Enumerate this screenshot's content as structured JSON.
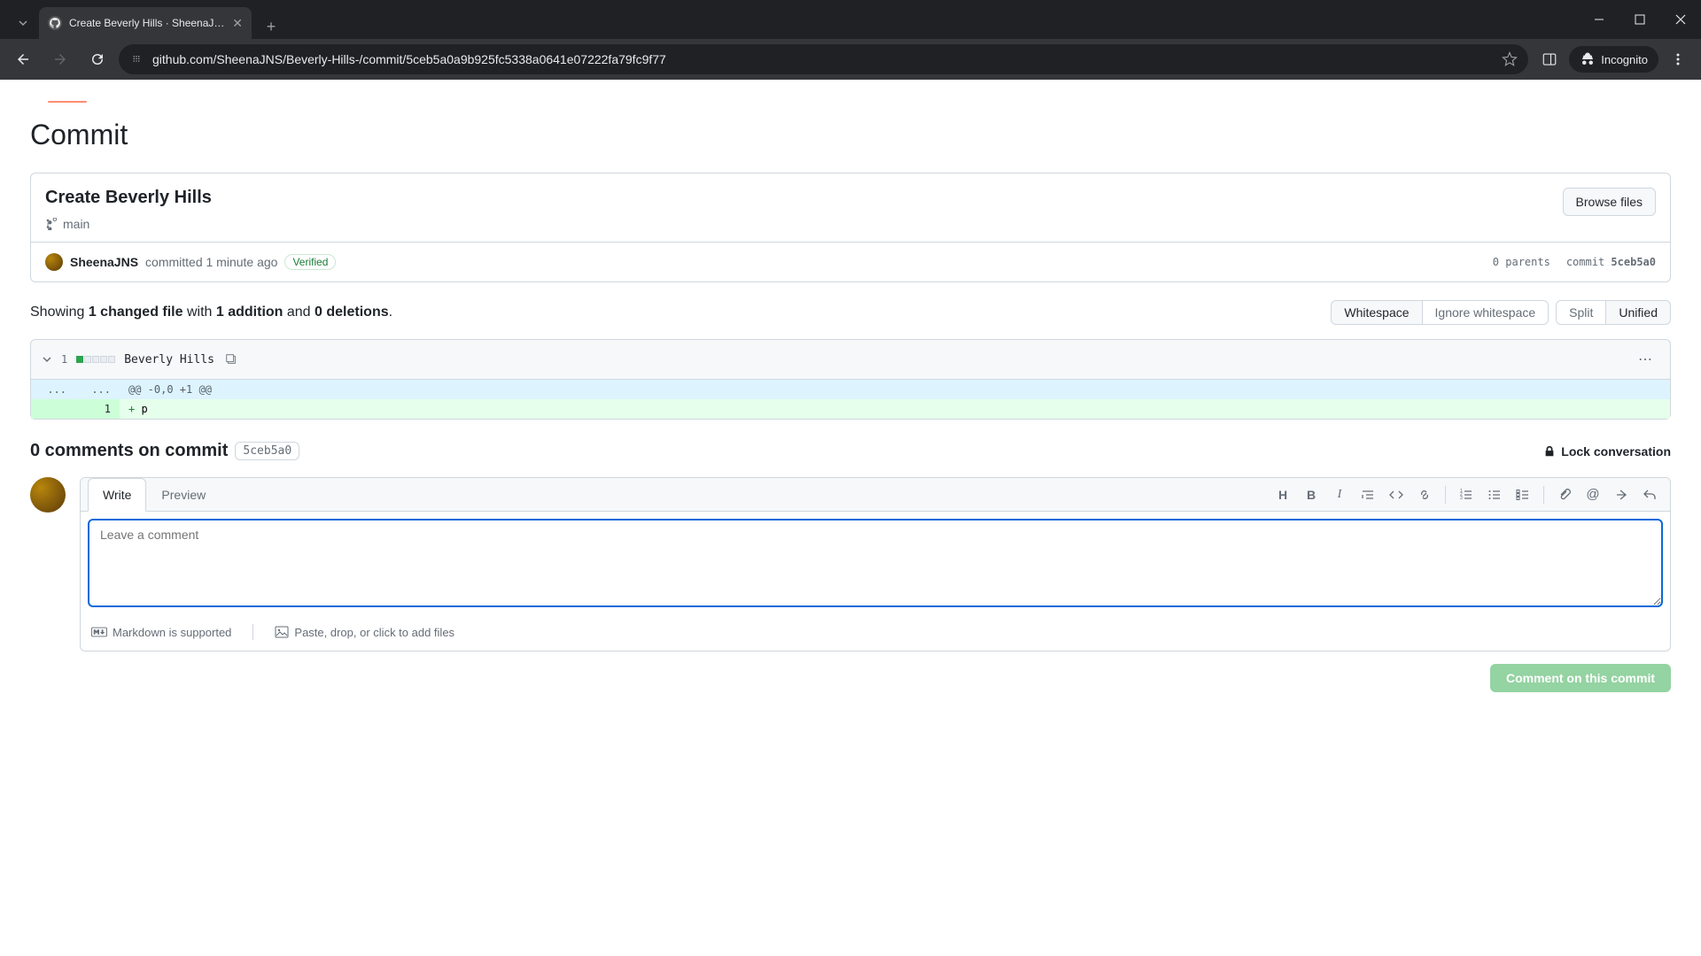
{
  "browser": {
    "tab_title": "Create Beverly Hills · SheenaJNS",
    "url": "github.com/SheenaJNS/Beverly-Hills-/commit/5ceb5a0a9b925fc5338a0641e07222fa79fc9f77",
    "incognito_label": "Incognito"
  },
  "page": {
    "heading": "Commit",
    "commit_title": "Create Beverly Hills",
    "branch": "main",
    "browse_files": "Browse files",
    "author": "SheenaJNS",
    "committed_text": "committed 1 minute ago",
    "verified": "Verified",
    "parents": "0 parents",
    "commit_label": "commit",
    "sha": "5ceb5a0"
  },
  "diff": {
    "summary_prefix": "Showing ",
    "changed_files": "1 changed file",
    "with": " with ",
    "additions": "1 addition",
    "and": " and ",
    "deletions": "0 deletions",
    "period": ".",
    "whitespace_btn": "Whitespace",
    "ignore_whitespace_btn": "Ignore whitespace",
    "split_btn": "Split",
    "unified_btn": "Unified",
    "file": {
      "changes_count": "1",
      "name": "Beverly Hills",
      "hunk": "@@ -0,0 +1 @@",
      "line_new": "1",
      "marker": "+",
      "content": "p"
    }
  },
  "comments": {
    "count_text": "0 comments on commit",
    "sha": "5ceb5a0",
    "lock": "Lock conversation",
    "write_tab": "Write",
    "preview_tab": "Preview",
    "placeholder": "Leave a comment",
    "markdown_supported": "Markdown is supported",
    "paste_hint": "Paste, drop, or click to add files",
    "submit": "Comment on this commit"
  }
}
